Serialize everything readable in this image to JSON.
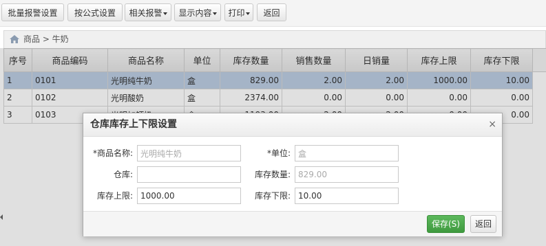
{
  "toolbar": {
    "batch_alarm": "批量报警设置",
    "formula": "按公式设置",
    "related_alarm": "相关报警",
    "display": "显示内容",
    "print": "打印",
    "back": "返回"
  },
  "breadcrumb": {
    "text": "商品 > 牛奶"
  },
  "grid": {
    "headers": [
      "序号",
      "商品编码",
      "商品名称",
      "单位",
      "库存数量",
      "销售数量",
      "日销量",
      "库存上限",
      "库存下限"
    ],
    "rows": [
      [
        "1",
        "0101",
        "光明纯牛奶",
        "盒",
        "829.00",
        "2.00",
        "2.00",
        "1000.00",
        "10.00"
      ],
      [
        "2",
        "0102",
        "光明酸奶",
        "盒",
        "2374.00",
        "0.00",
        "0.00",
        "0.00",
        "0.00"
      ],
      [
        "3",
        "0103",
        "光明加钙奶",
        "盒",
        "1193.00",
        "2.00",
        "2.00",
        "0.00",
        "0.00"
      ]
    ]
  },
  "dialog": {
    "title": "仓库库存上下限设置",
    "close": "×",
    "fields": {
      "name_label": "*商品名称:",
      "name_value": "光明纯牛奶",
      "unit_label": "*单位:",
      "unit_value": "盒",
      "warehouse_label": "仓库:",
      "warehouse_value": "",
      "stock_label": "库存数量:",
      "stock_value": "829.00",
      "upper_label": "库存上限:",
      "upper_value": "1000.00",
      "lower_label": "库存下限:",
      "lower_value": "10.00"
    },
    "save": "保存(S)",
    "back": "返回"
  }
}
